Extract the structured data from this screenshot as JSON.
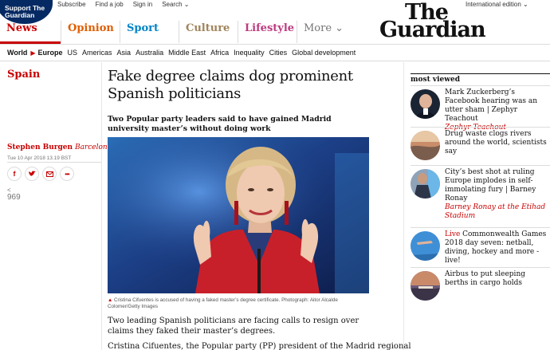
{
  "header": {
    "support_label": "Support The\nGuardian",
    "top_links": [
      "Subscribe",
      "Find a job",
      "Sign in",
      "Search ⌄"
    ],
    "edition": "International edition ⌄",
    "logo_line1": "The",
    "logo_line2": "Guardian"
  },
  "pillars": [
    {
      "label": "News",
      "color": "#c70000"
    },
    {
      "label": "Opinion",
      "color": "#e05e00"
    },
    {
      "label": "Sport",
      "color": "#0084c6"
    },
    {
      "label": "Culture",
      "color": "#a1845c"
    },
    {
      "label": "Lifestyle",
      "color": "#bb3b80"
    },
    {
      "label": "More ⌄",
      "color": "#767676"
    }
  ],
  "subnav": {
    "world": "World",
    "europe": "Europe",
    "items": [
      "US",
      "Americas",
      "Asia",
      "Australia",
      "Middle East",
      "Africa",
      "Inequality",
      "Cities",
      "Global development"
    ]
  },
  "article": {
    "section": "Spain",
    "author": "Stephen Burgen",
    "location": "Barcelona",
    "date": "Tue 10 Apr 2018 13.19 BST",
    "share_count": "969",
    "headline": "Fake degree claims dog prominent Spanish politicians",
    "standfirst": "Two Popular party leaders said to have gained Madrid university master’s without doing work",
    "caption": "Cristina Cifuentes is accused of having a faked master’s degree certificate. Photograph: Aitor Alcalde Colomer/Getty Images",
    "para1": "Two leading Spanish politicians are facing calls to resign over claims they faked their master’s degrees.",
    "para2": "Cristina Cifuentes, the Popular party (PP) president of the Madrid regional"
  },
  "most_viewed": {
    "title": "most viewed",
    "items": [
      {
        "kicker": "",
        "text": "Mark Zuckerberg’s Facebook hearing was an utter sham | Zephyr Teachout",
        "author": "Zephyr Teachout"
      },
      {
        "kicker": "",
        "text": "Drug waste clogs rivers around the world, scientists say",
        "author": ""
      },
      {
        "kicker": "",
        "text": "City’s best shot at ruling Europe implodes in self-immolating fury | Barney Ronay",
        "author": "Barney Ronay at the Etihad Stadium"
      },
      {
        "kicker": "Live",
        "text": " Commonwealth Games 2018 day seven: netball, diving, hockey and more - live!",
        "author": ""
      },
      {
        "kicker": "",
        "text": "Airbus to put sleeping berths in cargo holds",
        "author": ""
      }
    ]
  }
}
